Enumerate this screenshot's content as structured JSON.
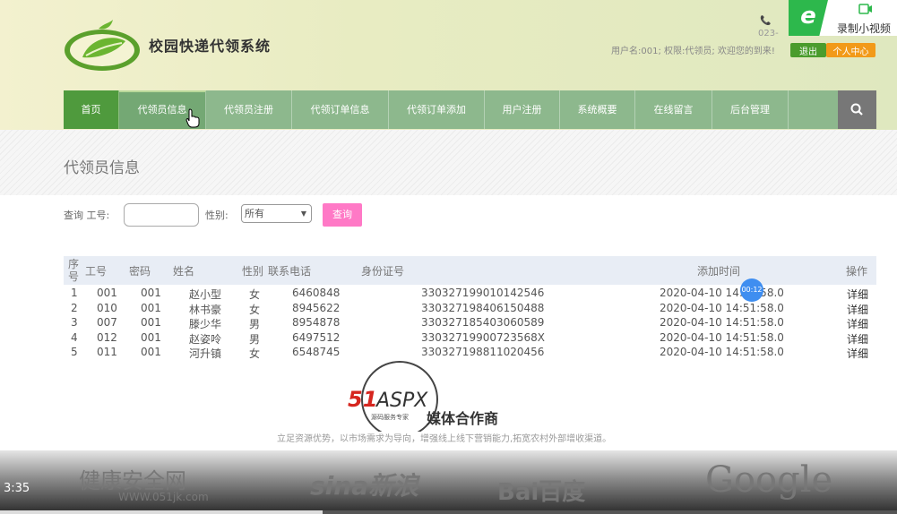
{
  "header": {
    "site_title": "校园快递代领系统",
    "phone_prefix": "023-",
    "welcome": "用户名:001; 权限:代领员; 欢迎您的到来!",
    "logout_label": "退出",
    "user_center_label": "个人中心"
  },
  "recorder": {
    "e_label": "e",
    "label": "录制小视频"
  },
  "nav": {
    "items": [
      {
        "label": "首页"
      },
      {
        "label": "代领员信息"
      },
      {
        "label": "代领员注册"
      },
      {
        "label": "代领订单信息"
      },
      {
        "label": "代领订单添加"
      },
      {
        "label": "用户注册"
      },
      {
        "label": "系统概要"
      },
      {
        "label": "在线留言"
      },
      {
        "label": "后台管理"
      }
    ],
    "search_icon": "search-icon"
  },
  "page": {
    "heading": "代领员信息"
  },
  "filter": {
    "id_label": "查询 工号:",
    "id_value": "",
    "gender_label": "性别:",
    "gender_selected": "所有",
    "query_label": "查询"
  },
  "table": {
    "headers": {
      "seq": "序号",
      "id": "工号",
      "password": "密码",
      "name": "姓名",
      "gender": "性别",
      "phone": "联系电话",
      "idcard": "身份证号",
      "added": "添加时间",
      "action": "操作"
    },
    "rows": [
      {
        "seq": "1",
        "id": "001",
        "password": "001",
        "name": "赵小型",
        "gender": "女",
        "phone": "6460848",
        "idcard": "330327199010142546",
        "added": "2020-04-10 14:51:58.0",
        "action": "详细"
      },
      {
        "seq": "2",
        "id": "010",
        "password": "001",
        "name": "林书豪",
        "gender": "女",
        "phone": "8945622",
        "idcard": "330327198406150488",
        "added": "2020-04-10 14:51:58.0",
        "action": "详细"
      },
      {
        "seq": "3",
        "id": "007",
        "password": "001",
        "name": "滕少华",
        "gender": "男",
        "phone": "8954878",
        "idcard": "330327185403060589",
        "added": "2020-04-10 14:51:58.0",
        "action": "详细"
      },
      {
        "seq": "4",
        "id": "012",
        "password": "001",
        "name": "赵姿呤",
        "gender": "男",
        "phone": "6497512",
        "idcard": "33032719900723568X",
        "added": "2020-04-10 14:51:58.0",
        "action": "详细"
      },
      {
        "seq": "5",
        "id": "011",
        "password": "001",
        "name": "河升镇",
        "gender": "女",
        "phone": "6548745",
        "idcard": "330327198811020456",
        "added": "2020-04-10 14:51:58.0",
        "action": "详细"
      }
    ]
  },
  "timer_badge": "00:12",
  "partners": {
    "logo_text": "51ASPX",
    "logo_subtext": "源码服务专家",
    "title": "媒体合作商",
    "description": "立足资源优势，以市场需求为导向，增强线上线下营销能力,拓宽农村外部增收渠道。",
    "logos": [
      {
        "name": "健康安全网",
        "sub": "WWW.051jk.com"
      },
      {
        "name": "sina新浪"
      },
      {
        "name": "Bai百度"
      },
      {
        "name": "Google"
      }
    ]
  },
  "video": {
    "time": "3:35",
    "progress": 0.36
  }
}
